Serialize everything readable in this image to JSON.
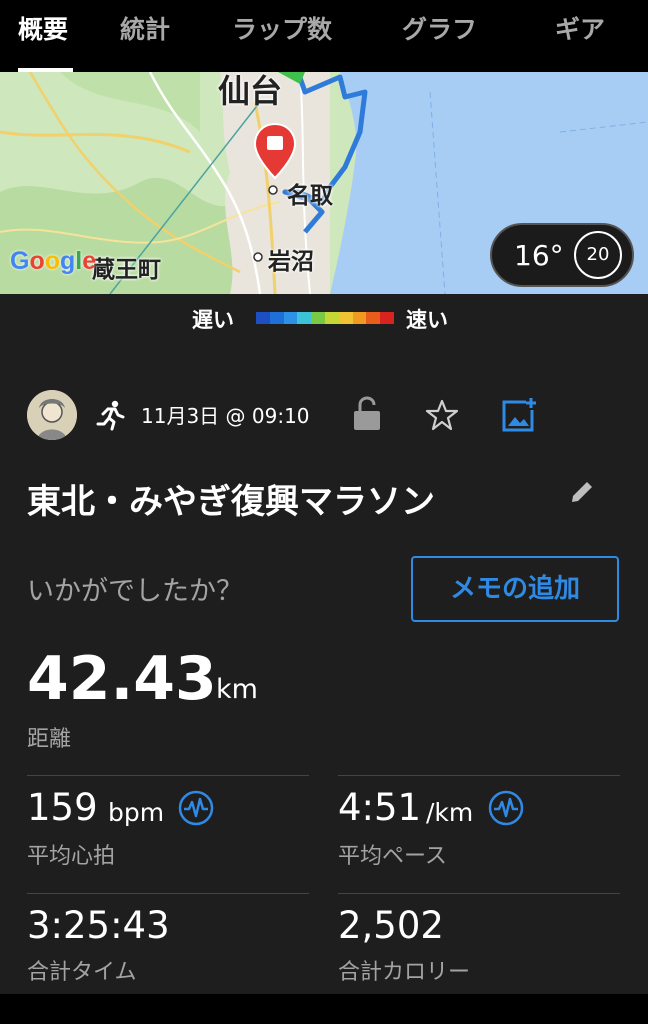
{
  "tabs": [
    "概要",
    "統計",
    "ラップ数",
    "グラフ",
    "ギア"
  ],
  "active_tab": 0,
  "map": {
    "places": [
      "仙台",
      "名取",
      "岩沼",
      "蔵王町"
    ],
    "attribution": "Google",
    "temperature": "16°",
    "temp_ring_value": "20"
  },
  "legend": {
    "slow": "遅い",
    "fast": "速い",
    "colors": [
      "#1e4fc2",
      "#1f6fd8",
      "#2d92e6",
      "#3dc3d8",
      "#7ac943",
      "#c6d634",
      "#f1c232",
      "#f09a22",
      "#e95d1c",
      "#d8231e"
    ]
  },
  "activity": {
    "date": "11月3日 @ 09:10",
    "title": "東北・みやぎ復興マラソン",
    "prompt": "いかがでしたか？",
    "memo_button": "メモの追加"
  },
  "stats": {
    "distance_value": "42.43",
    "distance_unit": "km",
    "distance_label": "距離",
    "hr_value": "159",
    "hr_unit": "bpm",
    "hr_label": "平均心拍",
    "pace_value": "4:51",
    "pace_unit": "/km",
    "pace_label": "平均ペース",
    "time_value": "3:25:43",
    "time_label": "合計タイム",
    "calories_value": "2,502",
    "calories_label": "合計カロリー"
  },
  "colors": {
    "accent": "#2f8ae5",
    "background": "#1e1e1e"
  }
}
